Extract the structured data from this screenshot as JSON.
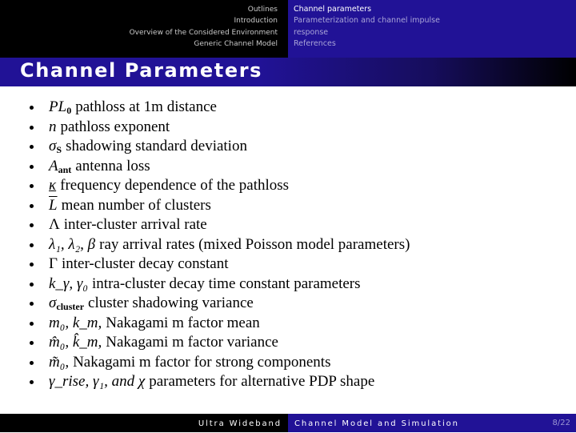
{
  "header": {
    "left_nav": [
      "Outlines",
      "Introduction",
      "Overview of the Considered Environment",
      "Generic Channel Model"
    ],
    "right_nav": [
      {
        "label": "Channel parameters",
        "active": true
      },
      {
        "label": "Parameterization and channel impulse",
        "active": false
      },
      {
        "label": "response",
        "active": false
      },
      {
        "label": "References",
        "active": false
      }
    ]
  },
  "slide": {
    "title": "Channel Parameters",
    "bullets": [
      {
        "symbol": "PL",
        "sub": "0",
        "text": "pathloss at 1m distance"
      },
      {
        "symbol": "n",
        "sub": "",
        "text": "pathloss exponent"
      },
      {
        "symbol": "σ",
        "sub": "S",
        "text": "shadowing standard deviation"
      },
      {
        "symbol": "A",
        "sub": "ant",
        "text": "antenna loss"
      },
      {
        "symbol": "κ",
        "sub": "",
        "text": "frequency dependence of the pathloss"
      },
      {
        "symbol": "L",
        "sub": "",
        "text": "mean number of clusters"
      },
      {
        "symbol": "Λ",
        "sub": "",
        "text": "inter-cluster arrival rate"
      },
      {
        "symbol": "λ₁, λ₂, β",
        "sub": "",
        "text": "ray arrival rates (mixed Poisson model parameters)"
      },
      {
        "symbol": "Γ",
        "sub": "",
        "text": "inter-cluster decay constant"
      },
      {
        "symbol": "k_γ, γ₀",
        "sub": "",
        "text": "intra-cluster decay time constant parameters"
      },
      {
        "symbol": "σ",
        "sub": "cluster",
        "text": "cluster shadowing variance"
      },
      {
        "symbol": "m₀, k_m,",
        "sub": "",
        "text": "Nakagami m factor mean"
      },
      {
        "symbol": "m̂₀, k̂_m,",
        "sub": "",
        "text": "Nakagami m factor variance"
      },
      {
        "symbol": "m̃₀,",
        "sub": "",
        "text": "Nakagami m factor for strong components"
      },
      {
        "symbol": "γ_rise, γ₁, and χ",
        "sub": "",
        "text": "parameters for alternative PDP shape"
      }
    ]
  },
  "footer": {
    "left_text": "Ultra Wideband",
    "right_text": "Channel Model and Simulation",
    "page": "8/22"
  },
  "colors": {
    "accent_blue": "#211296",
    "black": "#000000",
    "inactive_nav": "#a9a4d8"
  }
}
